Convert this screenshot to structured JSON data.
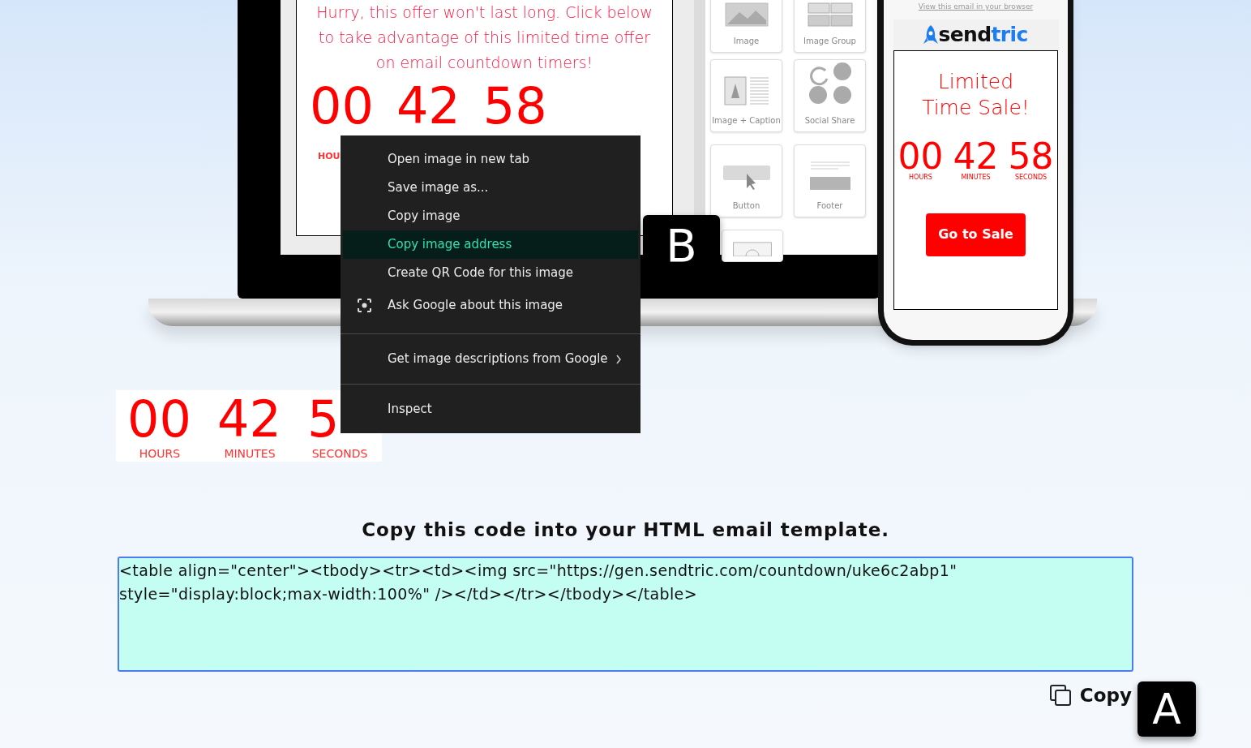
{
  "mockup": {
    "laptop": {
      "email_text": "Hurry, this offer won't last long. Click below to take advantage of this limited time offer on email countdown timers!",
      "countdown": [
        "00",
        "42",
        "58"
      ],
      "countdown_label": "HOU",
      "blocks": [
        {
          "label": "Image",
          "kind": "image"
        },
        {
          "label": "Image Group",
          "kind": "image_group"
        },
        {
          "label": "Image + Caption",
          "kind": "caption"
        },
        {
          "label": "Social Share",
          "kind": "social"
        },
        {
          "label": "Button",
          "kind": "button"
        },
        {
          "label": "Footer",
          "kind": "footer"
        },
        {
          "kind": "partial"
        }
      ]
    },
    "phone": {
      "top_link": "View this email in your browser",
      "logo_parts": [
        "send",
        "tric"
      ],
      "title": "Limited Time Sale!",
      "countdown": [
        {
          "value": "00",
          "unit": "HOURS"
        },
        {
          "value": "42",
          "unit": "MINUTES"
        },
        {
          "value": "58",
          "unit": "SECONDS"
        }
      ],
      "button": "Go to Sale"
    }
  },
  "countdown_image": [
    {
      "value": "00",
      "unit": "HOURS"
    },
    {
      "value": "42",
      "unit": "MINUTES"
    },
    {
      "value": "5",
      "unit": "SECONDS"
    }
  ],
  "context_menu": {
    "groups": [
      [
        {
          "label": "Open image in new tab",
          "kind": "plain",
          "selected": false
        },
        {
          "label": "Save image as...",
          "kind": "plain",
          "selected": false
        },
        {
          "label": "Copy image",
          "kind": "plain",
          "selected": false
        },
        {
          "label": "Copy image address",
          "kind": "plain",
          "selected": true
        },
        {
          "label": "Create QR Code for this image",
          "kind": "plain",
          "selected": false
        },
        {
          "label": "Ask Google about this image",
          "kind": "lens",
          "selected": false
        }
      ],
      [
        {
          "label": "Get image descriptions from Google",
          "kind": "submenu",
          "selected": false
        }
      ],
      [
        {
          "label": "Inspect",
          "kind": "plain",
          "selected": false
        }
      ]
    ]
  },
  "menu_callout": "B",
  "heading": "Copy this code into your HTML email template.",
  "code_field": {
    "value": "<table align=\"center\"><tbody><tr><td><img src=\"https://gen.sendtric.com/countdown/uke6c2abp1\" style=\"display:block;max-width:100%\" /></td></tr></tbody></table>"
  },
  "copy_button": "Copy",
  "copy_callout": "A"
}
